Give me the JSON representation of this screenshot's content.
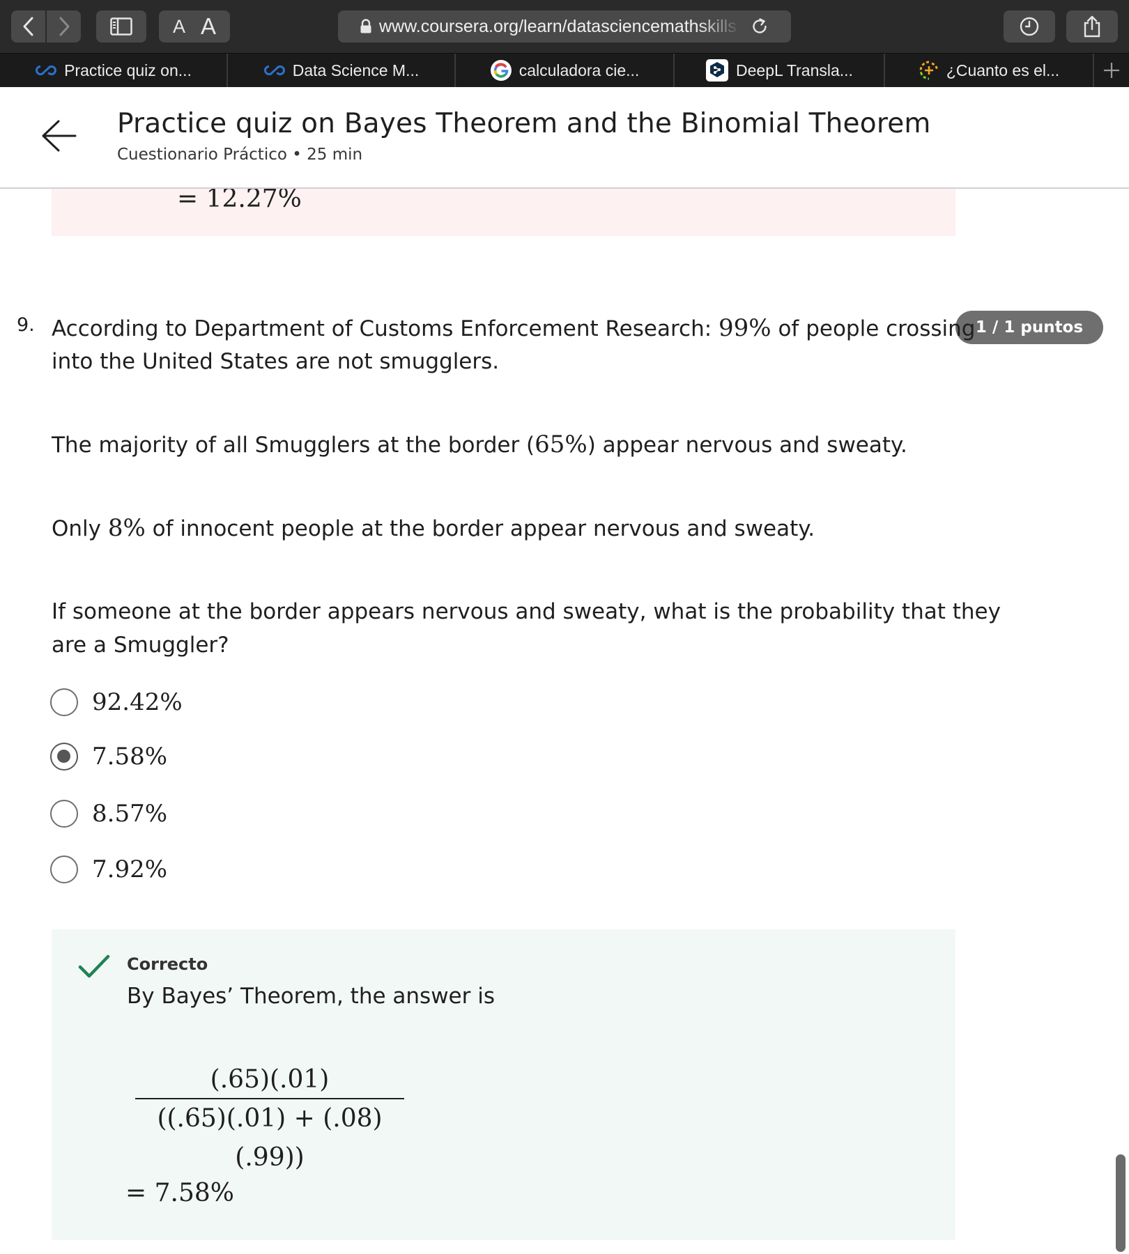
{
  "browser": {
    "url": "www.coursera.org/learn/datasciencemathskills",
    "text_size_small": "A",
    "text_size_large": "A",
    "tabs": [
      {
        "label": "Practice quiz on...",
        "icon": "coursera-icon"
      },
      {
        "label": "Data Science M...",
        "icon": "coursera-icon"
      },
      {
        "label": "calculadora cie...",
        "icon": "google-icon"
      },
      {
        "label": "DeepL Transla...",
        "icon": "deepl-icon"
      },
      {
        "label": "¿Cuanto es el...",
        "icon": "spinner-icon"
      }
    ],
    "colors": {
      "toolbar": "#2b2a2b",
      "tabstrip": "#1c1b1c",
      "coursera": "#2a73cc"
    }
  },
  "header": {
    "title": "Practice quiz on Bayes Theorem and the Binomial Theorem",
    "subtitle": "Cuestionario Práctico • 25 min"
  },
  "previous_feedback": {
    "equation": "= 12.27%"
  },
  "question": {
    "number": "9.",
    "score": "1 / 1 puntos",
    "line1_before": "According to Department of Customs Enforcement Research: ",
    "line1_math": "99%",
    "line1_after": " of people crossing",
    "line2": "into the United States are not smugglers.",
    "p2_before": "The majority of all Smugglers at the border (",
    "p2_math": "65%",
    "p2_after": ") appear nervous and sweaty.",
    "p3_before": "Only ",
    "p3_math": "8%",
    "p3_after": " of innocent people at the border appear nervous and sweaty.",
    "p4_line1": "If someone at the border appears nervous and sweaty, what is the probability that they",
    "p4_line2": "are a Smuggler?",
    "options": [
      {
        "label": "92.42%",
        "selected": false
      },
      {
        "label": "7.58%",
        "selected": true
      },
      {
        "label": "8.57%",
        "selected": false
      },
      {
        "label": "7.92%",
        "selected": false
      }
    ]
  },
  "feedback": {
    "status": "Correcto",
    "text": "By Bayes’ Theorem, the answer is",
    "numerator": "(.65)(.01)",
    "denominator": "((.65)(.01) + (.08)(.99))",
    "result": "= 7.58%",
    "colors": {
      "check": "#1f8354",
      "background": "#f2f8f6"
    }
  }
}
